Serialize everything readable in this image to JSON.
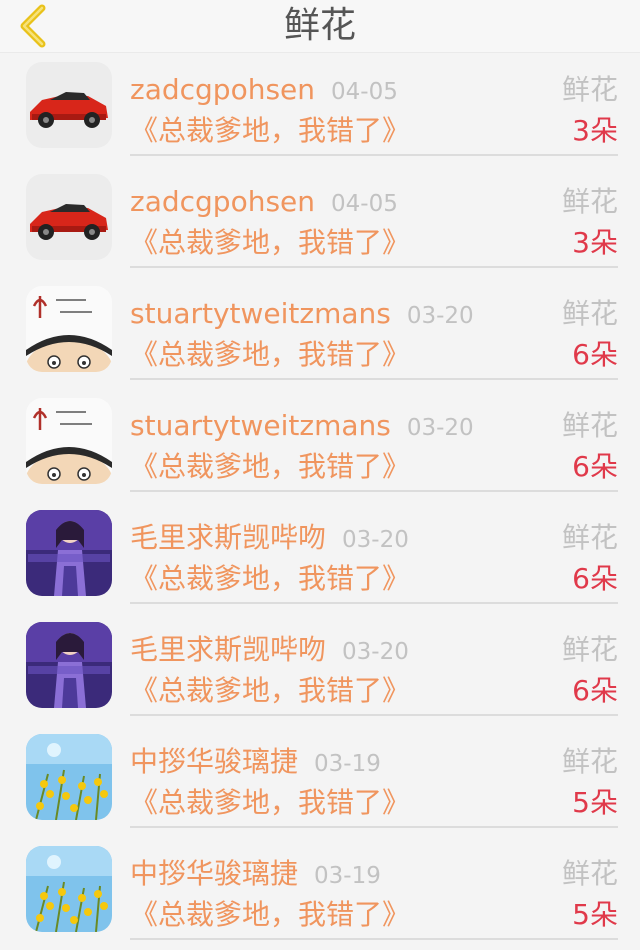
{
  "header": {
    "title": "鲜花",
    "back_icon": "chevron-left-icon"
  },
  "colors": {
    "name": "#f0955e",
    "book": "#f0955e",
    "date": "#c2c2c2",
    "gift_type": "#c2c2c2",
    "gift_count": "#e0394a",
    "back_icon": "#e9c21a"
  },
  "items": [
    {
      "avatar": "red-sports-car",
      "name": "zadcgpohsen",
      "date": "04-05",
      "book": "《总裁爹地，我错了》",
      "gift_type": "鲜花",
      "count": "3朵"
    },
    {
      "avatar": "red-sports-car",
      "name": "zadcgpohsen",
      "date": "04-05",
      "book": "《总裁爹地，我错了》",
      "gift_type": "鲜花",
      "count": "3朵"
    },
    {
      "avatar": "cartoon-face",
      "name": "stuartytweitzmans",
      "date": "03-20",
      "book": "《总裁爹地，我错了》",
      "gift_type": "鲜花",
      "count": "6朵"
    },
    {
      "avatar": "cartoon-face",
      "name": "stuartytweitzmans",
      "date": "03-20",
      "book": "《总裁爹地，我错了》",
      "gift_type": "鲜花",
      "count": "6朵"
    },
    {
      "avatar": "purple-girl",
      "name": "毛里求斯觊哔吻",
      "date": "03-20",
      "book": "《总裁爹地，我错了》",
      "gift_type": "鲜花",
      "count": "6朵"
    },
    {
      "avatar": "purple-girl",
      "name": "毛里求斯觊哔吻",
      "date": "03-20",
      "book": "《总裁爹地，我错了》",
      "gift_type": "鲜花",
      "count": "6朵"
    },
    {
      "avatar": "yellow-flowers-sky",
      "name": "中拶华骏璃捷",
      "date": "03-19",
      "book": "《总裁爹地，我错了》",
      "gift_type": "鲜花",
      "count": "5朵"
    },
    {
      "avatar": "yellow-flowers-sky",
      "name": "中拶华骏璃捷",
      "date": "03-19",
      "book": "《总裁爹地，我错了》",
      "gift_type": "鲜花",
      "count": "5朵"
    }
  ]
}
